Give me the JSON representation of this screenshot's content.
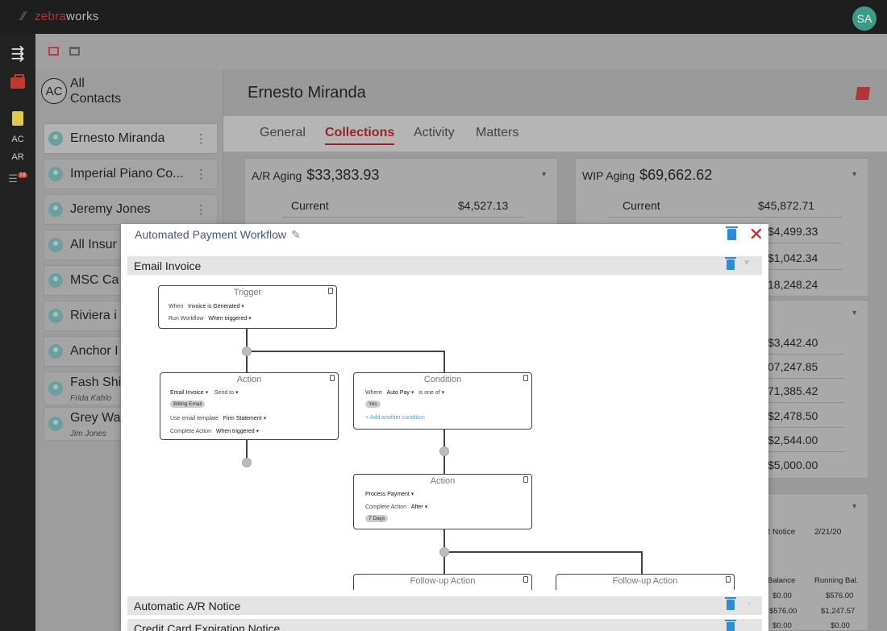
{
  "app": {
    "brand_prefix": "zebra",
    "brand_suffix": "works",
    "user_initials": "SA"
  },
  "rail": {
    "ac_label": "AC",
    "ar_label": "AR",
    "tasks_badge": "18"
  },
  "contacts_panel": {
    "all_initials": "AC",
    "all_label_line1": "All",
    "all_label_line2": "Contacts",
    "items": [
      {
        "name": "Ernesto Miranda",
        "sub": ""
      },
      {
        "name": "Imperial Piano Co...",
        "sub": ""
      },
      {
        "name": "Jeremy Jones",
        "sub": ""
      },
      {
        "name": "All Insur",
        "sub": ""
      },
      {
        "name": "MSC Ca",
        "sub": ""
      },
      {
        "name": "Riviera i",
        "sub": ""
      },
      {
        "name": "Anchor I",
        "sub": ""
      },
      {
        "name": "Fash Shi",
        "sub": "Frida Kahlo"
      },
      {
        "name": "Grey Wa",
        "sub": "Jim Jones"
      }
    ]
  },
  "detail": {
    "title": "Ernesto Miranda",
    "tabs": [
      "General",
      "Collections",
      "Activity",
      "Matters"
    ],
    "active_tab": "Collections",
    "ar_aging": {
      "label": "A/R Aging",
      "amount": "$33,383.93",
      "current_label": "Current",
      "current_value": "$4,527.13"
    },
    "wip_aging": {
      "label": "WIP Aging",
      "amount": "$69,662.62",
      "current_label": "Current",
      "current_value": "$45,872.71",
      "values": [
        "$4,499.33",
        "$1,042.34",
        "18,248.24"
      ]
    },
    "second_card_values": [
      "$3,442.40",
      "07,247.85",
      "71,385.42",
      "$2,478.50",
      "$2,544.00",
      "$5,000.00"
    ],
    "notice_card": {
      "notice_label": "R Notice",
      "notice_date": "2/21/20",
      "col_balance": "Balance",
      "col_running": "Running Bal.",
      "rows": [
        {
          "balance": "$0.00",
          "running": "$576.00"
        },
        {
          "balance": "$576.00",
          "running": "$1,247.57"
        },
        {
          "balance": "$0.00",
          "running": "$0.00"
        }
      ]
    }
  },
  "modal": {
    "title": "Automated Payment Workflow",
    "sections": [
      "Email Invoice",
      "Automatic A/R Notice",
      "Credit Card Expiration Notice"
    ],
    "workflow": {
      "trigger": {
        "title": "Trigger",
        "when_label": "When",
        "when_value": "Invoice is Generated",
        "run_label": "Run Workflow",
        "run_value": "When triggered"
      },
      "action1": {
        "title": "Action",
        "action_value": "Email Invoice",
        "send_label": "Send to",
        "chip": "Billing Email",
        "template_label": "Use email template",
        "template_value": "Firm Statement",
        "complete_label": "Complete Action",
        "complete_value": "When triggered"
      },
      "condition": {
        "title": "Condition",
        "where_label": "Where",
        "where_value": "Auto Pay",
        "op_value": "is one of",
        "chip": "Yes",
        "add_link": "+ Add another condition"
      },
      "action2": {
        "title": "Action",
        "action_value": "Process Payment",
        "complete_label": "Complete Action",
        "complete_value": "After",
        "chip": "7 Days"
      },
      "followup1": {
        "title": "Follow-up Action"
      },
      "followup2": {
        "title": "Follow-up Action"
      }
    }
  }
}
